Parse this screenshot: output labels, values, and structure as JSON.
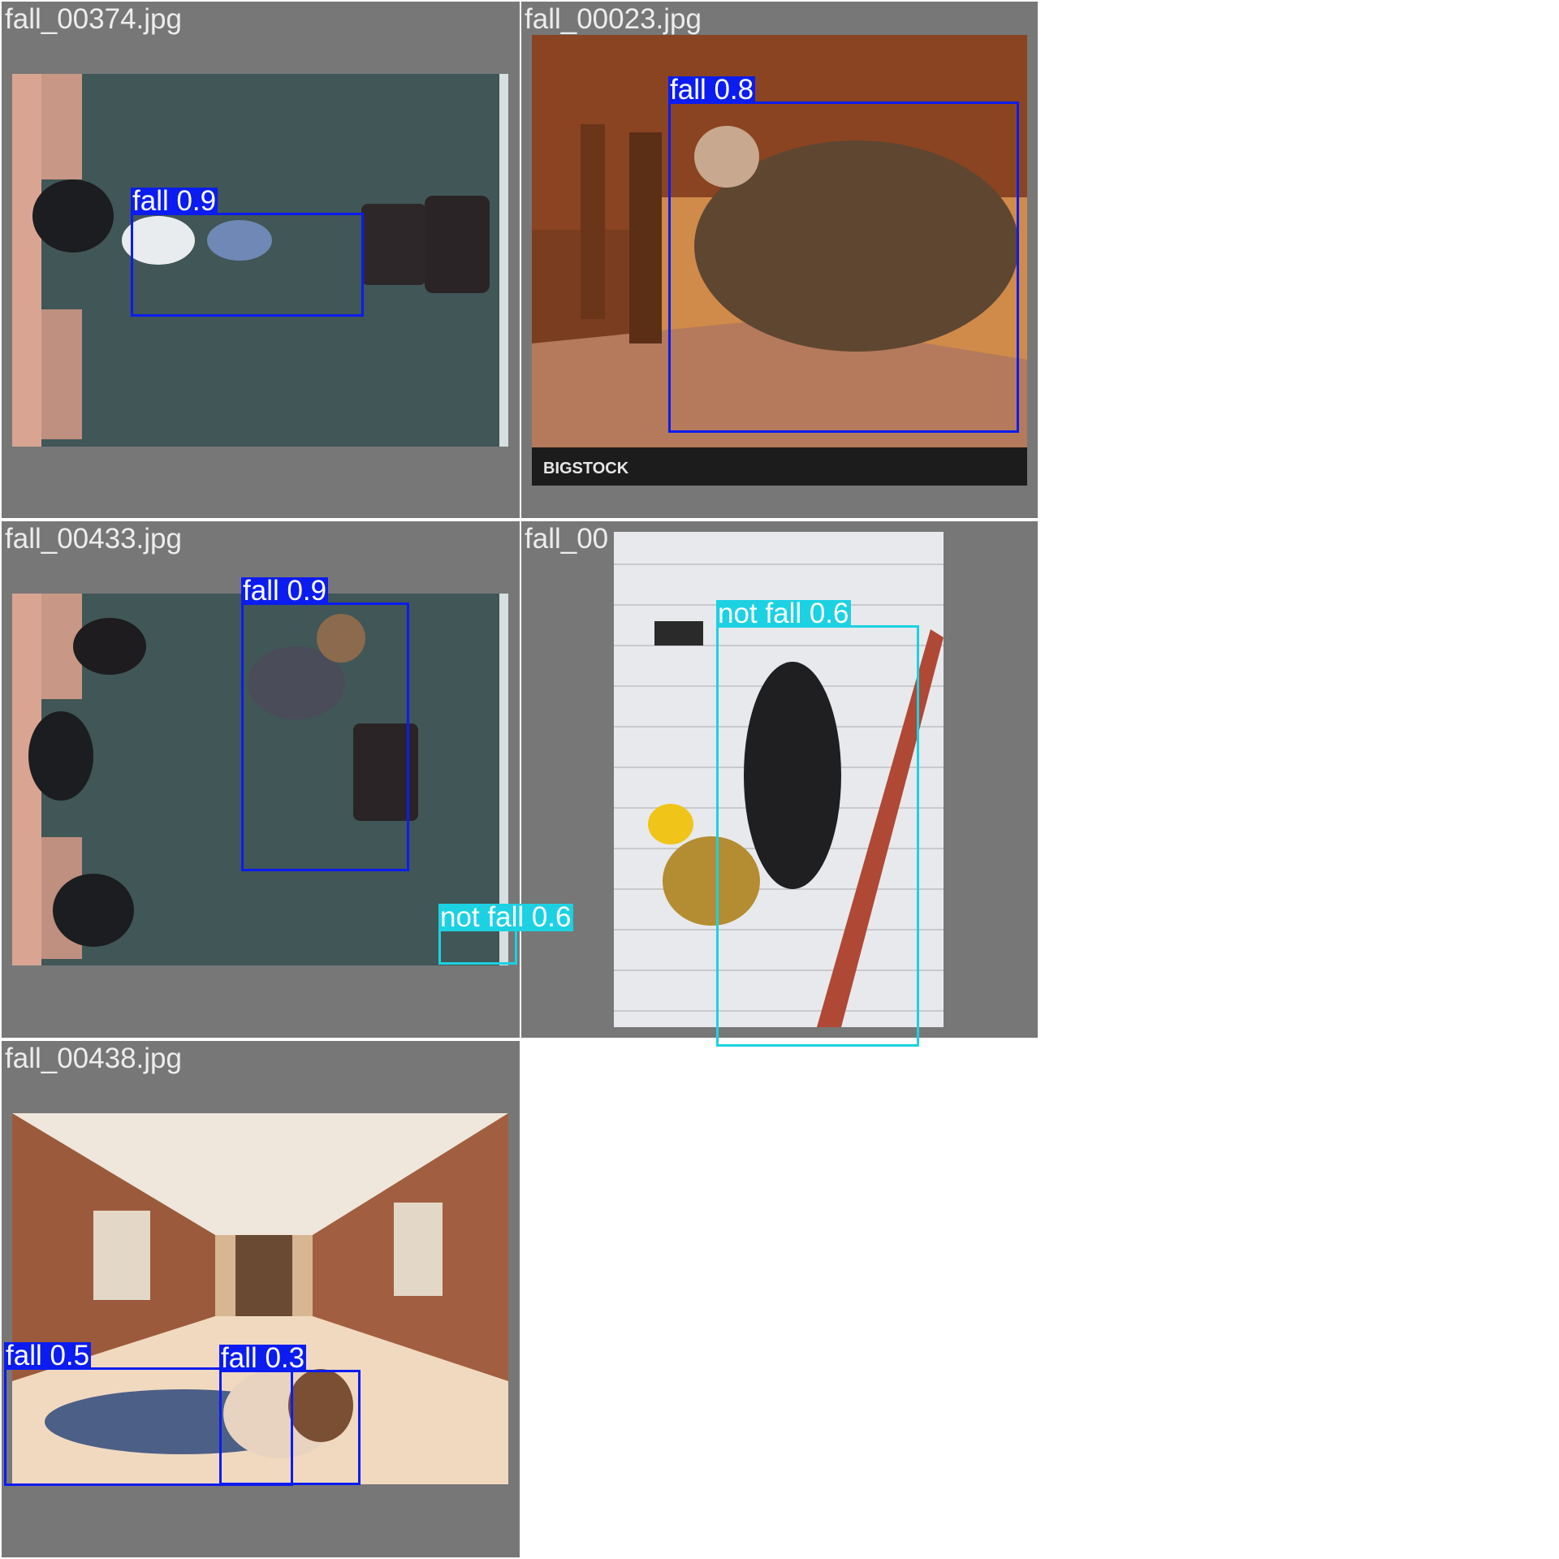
{
  "tiles": [
    {
      "filename": "fall_00374.jpg",
      "scene": "overhead-office-floor",
      "detections": [
        {
          "label": "fall 0.9",
          "class": "fall",
          "confidence": 0.9
        }
      ]
    },
    {
      "filename": "fall_00023.jpg",
      "scene": "man-on-stairs",
      "watermark": "BIGSTOCK",
      "detections": [
        {
          "label": "fall 0.8",
          "class": "fall",
          "confidence": 0.8
        }
      ]
    },
    {
      "filename": "fall_00433.jpg",
      "scene": "overhead-office-floor",
      "detections": [
        {
          "label": "fall 0.9",
          "class": "fall",
          "confidence": 0.9
        },
        {
          "label": "not fall 0.6",
          "class": "not fall",
          "confidence": 0.6
        }
      ]
    },
    {
      "filename": "fall_00",
      "scene": "worker-falling-from-ladder",
      "detections": [
        {
          "label": "not fall 0.6",
          "class": "not fall",
          "confidence": 0.6
        }
      ]
    },
    {
      "filename": "fall_00438.jpg",
      "scene": "school-hallway",
      "detections": [
        {
          "label": "fall 0.5",
          "class": "fall",
          "confidence": 0.5
        },
        {
          "label": "fall 0.3",
          "class": "fall",
          "confidence": 0.3
        }
      ]
    }
  ],
  "colors": {
    "tile_background": "#777777",
    "fall": "#0b1cf0",
    "not_fall": "#1cd1e2",
    "filename_text": "#ededed"
  }
}
